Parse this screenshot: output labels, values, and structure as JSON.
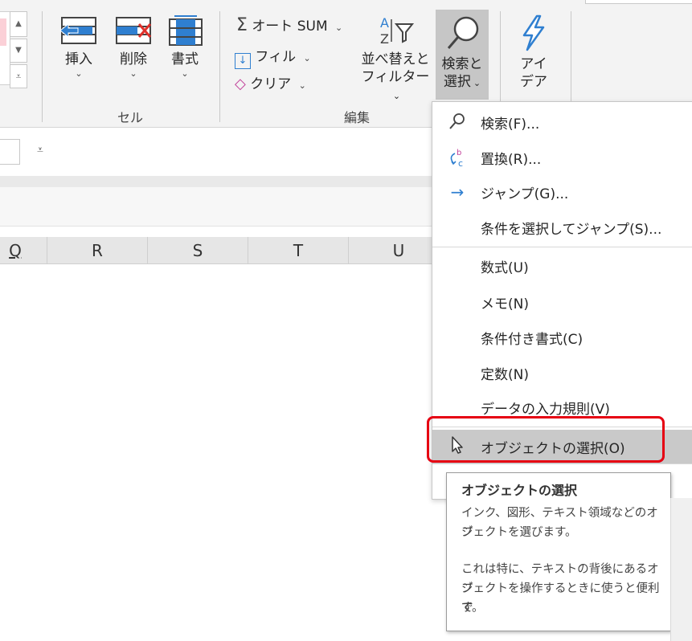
{
  "ribbon": {
    "cells_group": {
      "label": "セル",
      "insert": "挿入",
      "delete": "削除",
      "format": "書式"
    },
    "editing_group": {
      "label": "編集",
      "autosum": "オート SUM",
      "fill": "フィル",
      "clear": "クリア",
      "sort_filter_line1": "並べ替えと",
      "sort_filter_line2": "フィルター",
      "find_select_line1": "検索と",
      "find_select_line2": "選択"
    },
    "ideas_group": {
      "ideas_line1": "アイ",
      "ideas_line2": "デア"
    }
  },
  "formula_bar": {
    "toggle_icon": "⩡"
  },
  "columns": [
    "Q",
    "R",
    "S",
    "T",
    "U"
  ],
  "menu": {
    "items": [
      {
        "label": "検索(F)...",
        "icon": "search-icon"
      },
      {
        "label": "置換(R)...",
        "icon": "replace-icon"
      },
      {
        "label": "ジャンプ(G)...",
        "icon": "arrow-right-icon"
      },
      {
        "label": "条件を選択してジャンプ(S)...",
        "icon": ""
      },
      {
        "label": "数式(U)",
        "icon": ""
      },
      {
        "label": "メモ(N)",
        "icon": ""
      },
      {
        "label": "条件付き書式(C)",
        "icon": ""
      },
      {
        "label": "定数(N)",
        "icon": ""
      },
      {
        "label": "データの入力規則(V)",
        "icon": ""
      },
      {
        "label": "オブジェクトの選択(O)",
        "icon": "cursor-icon"
      }
    ]
  },
  "tooltip": {
    "title": "オブジェクトの選択",
    "body1_line1": "インク、図形、テキスト領域などのオブ",
    "body1_line2": "ジェクトを選びます。",
    "body2_line1": "これは特に、テキストの背後にあるオブ",
    "body2_line2": "ジェクトを操作するときに使うと便利で",
    "body2_line3": "す。"
  },
  "colors": {
    "highlight_border": "#e60012",
    "icon_blue": "#2f7fd0",
    "icon_red": "#e0312b"
  }
}
